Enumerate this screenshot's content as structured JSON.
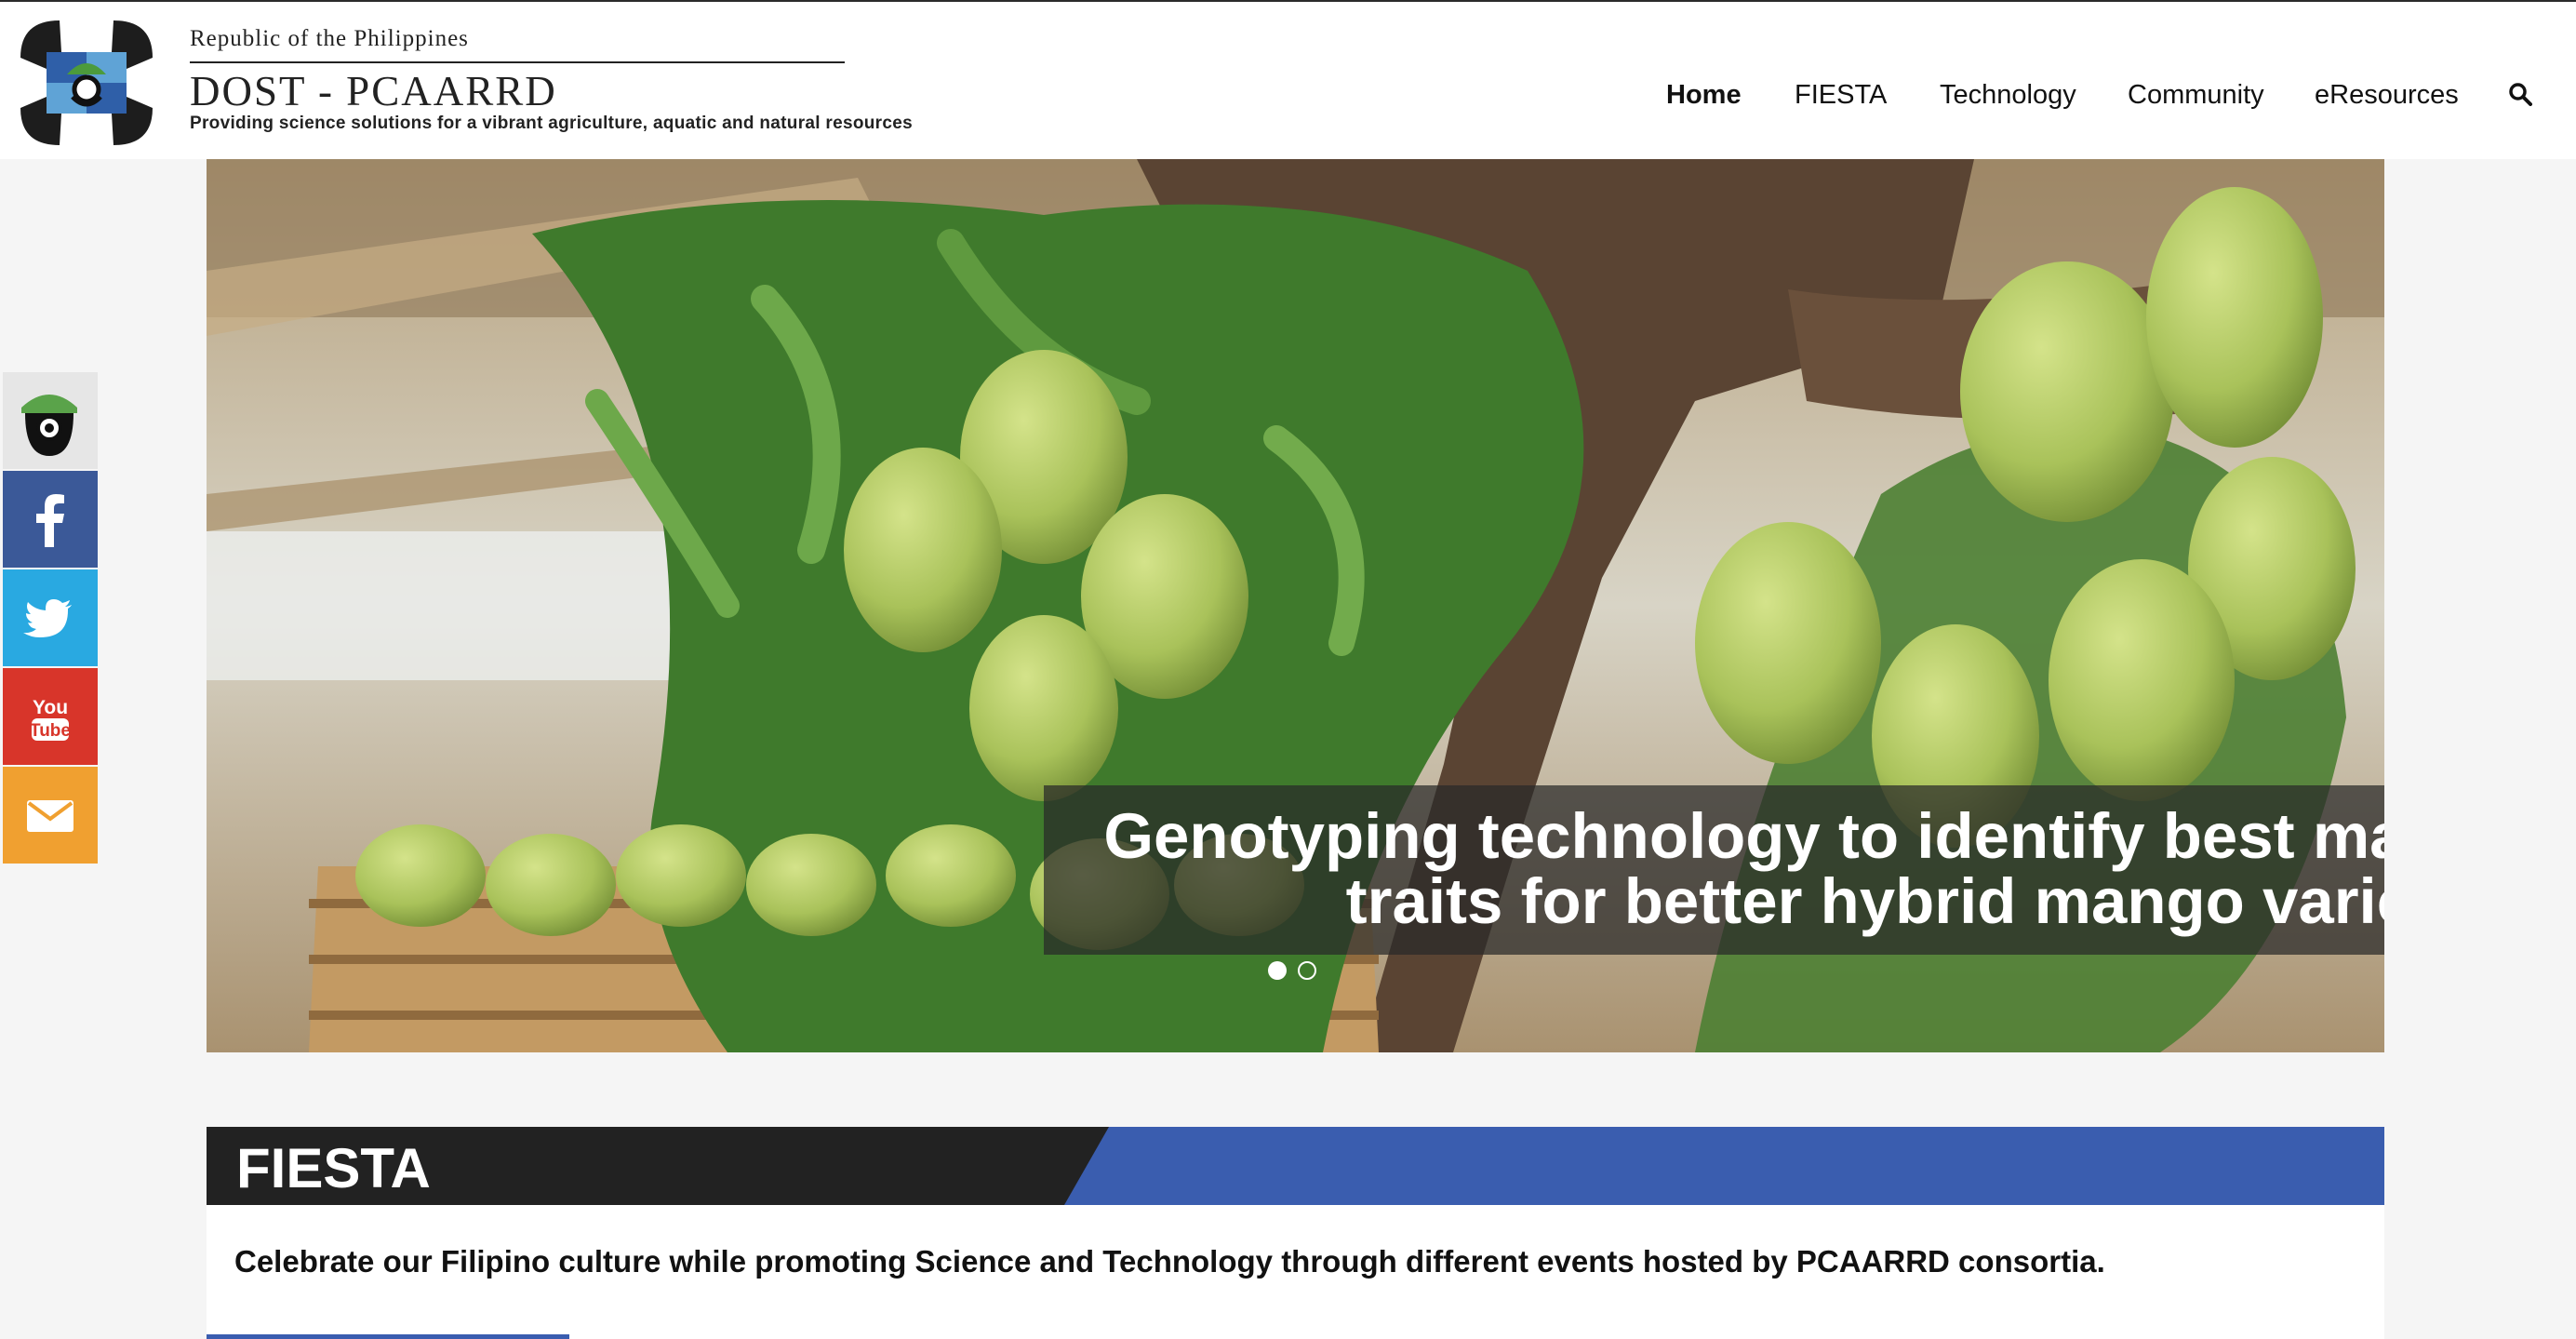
{
  "header": {
    "republic": "Republic of the Philippines",
    "agency": "DOST - PCAARRD",
    "tagline": "Providing science solutions for a vibrant agriculture, aquatic and natural resources"
  },
  "nav": {
    "items": [
      {
        "label": "Home",
        "active": true
      },
      {
        "label": "FIESTA",
        "active": false
      },
      {
        "label": "Technology",
        "active": false
      },
      {
        "label": "Community",
        "active": false
      },
      {
        "label": "eResources",
        "active": false
      }
    ],
    "search_icon": "search-icon"
  },
  "social": {
    "items": [
      {
        "name": "pcaarrd",
        "icon": "pcaarrd-logo-icon",
        "color": "#e6e6e6"
      },
      {
        "name": "facebook",
        "icon": "facebook-icon",
        "color": "#3b5998"
      },
      {
        "name": "twitter",
        "icon": "twitter-icon",
        "color": "#29a9e1"
      },
      {
        "name": "youtube",
        "icon": "youtube-icon",
        "color": "#d8352a",
        "text_top": "You",
        "text_bottom": "Tube"
      },
      {
        "name": "email",
        "icon": "email-icon",
        "color": "#f0a030"
      }
    ]
  },
  "hero": {
    "caption_line1": "Genotyping technology to identify best mango",
    "caption_line2": "traits for better hybrid mango varieties",
    "slide_count": 2,
    "active_slide": 1
  },
  "fiesta": {
    "title": "FIESTA",
    "description": "Celebrate our Filipino culture while promoting Science and Technology through different events hosted by PCAARRD consortia.",
    "colors": {
      "dark": "#222222",
      "accent": "#3a5daf"
    }
  }
}
